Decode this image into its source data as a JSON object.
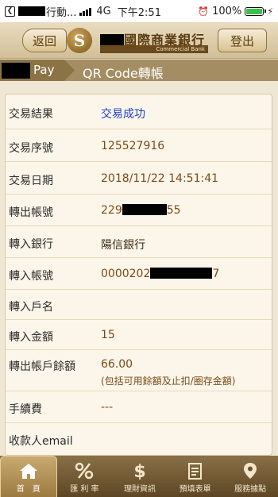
{
  "status_bar": {
    "carrier_suffix": "行動...",
    "network": "4G",
    "time": "下午2:51",
    "battery": "100%",
    "battery_level": 1.0
  },
  "header": {
    "back_label": "返回",
    "bank_name": "國際商業銀行",
    "bank_subtitle": "Commercial Bank",
    "logout_label": "登出",
    "logo_letter": "S"
  },
  "titlebar": {
    "pay_label": "Pay",
    "title": "QR Code轉帳"
  },
  "details": [
    {
      "label": "交易結果",
      "value": "交易成功"
    },
    {
      "label": "交易序號",
      "value": "125527916"
    },
    {
      "label": "交易日期",
      "value": "2018/11/22 14:51:41"
    },
    {
      "label": "轉出帳號",
      "value_prefix": "229",
      "value_suffix": "55"
    },
    {
      "label": "轉入銀行",
      "value": "陽信銀行"
    },
    {
      "label": "轉入帳號",
      "value_prefix": "0000202",
      "value_suffix": "7"
    },
    {
      "label": "轉入戶名",
      "value": ""
    },
    {
      "label": "轉入金額",
      "value": "15"
    },
    {
      "label": "轉出帳戶餘額",
      "value": "66.00",
      "note": "(包括可用餘額及止扣/圈存金額)"
    },
    {
      "label": "手續費",
      "value": "---"
    },
    {
      "label": "收款人email",
      "value": ""
    }
  ],
  "tabs": [
    {
      "label": "首　頁",
      "icon": "home-icon",
      "active": true
    },
    {
      "label": "匯 利 率",
      "icon": "percent-icon",
      "active": false
    },
    {
      "label": "理財資訊",
      "icon": "dollar-icon",
      "active": false
    },
    {
      "label": "預填表單",
      "icon": "form-icon",
      "active": false
    },
    {
      "label": "服務據點",
      "icon": "location-icon",
      "active": false
    }
  ],
  "colors": {
    "accent_brown": "#7a4a16",
    "success_blue": "#1a3fcb",
    "battery_green": "#38c24a"
  }
}
